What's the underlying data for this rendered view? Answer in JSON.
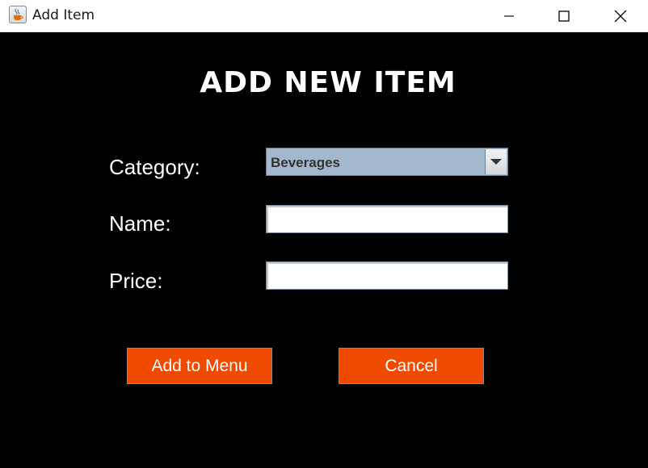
{
  "window": {
    "title": "Add Item",
    "app_icon": "java-coffee-icon",
    "controls": {
      "minimize_icon": "minimize-icon",
      "maximize_icon": "maximize-icon",
      "close_icon": "close-icon"
    }
  },
  "form": {
    "heading": "ADD NEW ITEM",
    "category_label": "Category:",
    "category_value": "Beverages",
    "name_label": "Name:",
    "name_value": "",
    "price_label": "Price:",
    "price_value": ""
  },
  "buttons": {
    "add_label": "Add to Menu",
    "cancel_label": "Cancel"
  },
  "colors": {
    "background": "#000000",
    "button": "#f04a00",
    "combo": "#a3b8cc",
    "text": "#ffffff"
  }
}
